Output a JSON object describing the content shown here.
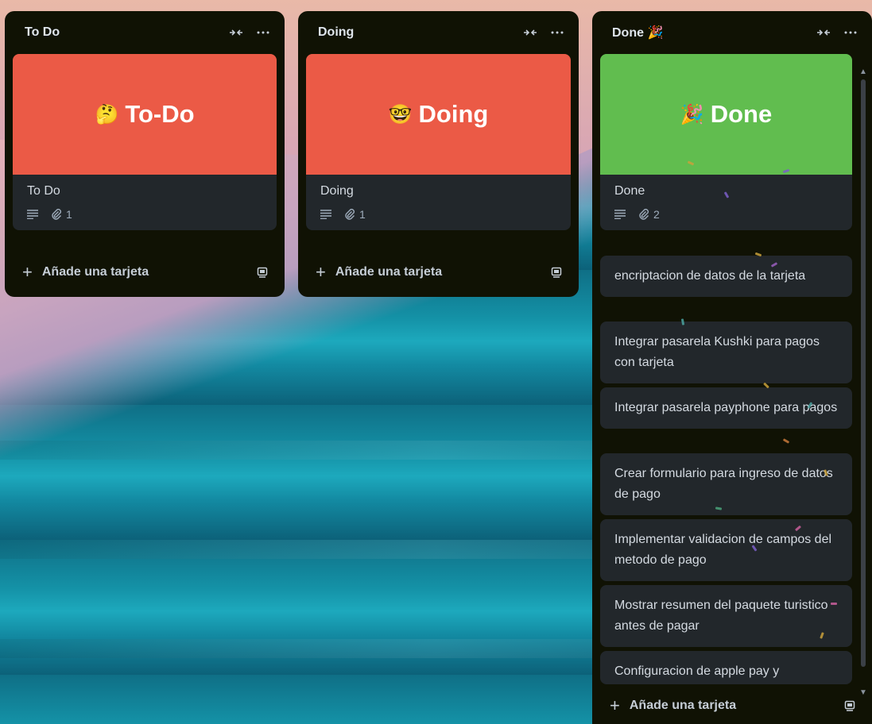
{
  "lists": [
    {
      "title": "To Do",
      "card": {
        "cover_emoji": "🤔",
        "cover_text": "To-Do",
        "cover_color": "#eb5a46",
        "title": "To Do",
        "attachments": "1"
      },
      "add_label": "Añade una tarjeta"
    },
    {
      "title": "Doing",
      "card": {
        "cover_emoji": "🤓",
        "cover_text": "Doing",
        "cover_color": "#eb5a46",
        "title": "Doing",
        "attachments": "1"
      },
      "add_label": "Añade una tarjeta"
    },
    {
      "title": "Done 🎉",
      "card": {
        "cover_emoji": "🎉",
        "cover_text": "Done",
        "cover_color": "#61bd4f",
        "title": "Done",
        "attachments": "2"
      },
      "add_label": "Añade una tarjeta",
      "cards": [
        "encriptacion de datos de la tarjeta",
        "Integrar pasarela Kushki para pagos con tarjeta",
        "Integrar pasarela payphone para pagos",
        "Crear formulario para ingreso de datos de pago",
        "Implementar validacion de campos del metodo de pago",
        "Mostrar resumen del paquete turistico antes de pagar",
        "Configuracion de apple pay y"
      ]
    }
  ],
  "icons": {
    "collapse": "collapse-icon",
    "more": "more-icon",
    "description": "description-icon",
    "attachment": "paperclip-icon",
    "add": "plus-icon",
    "template": "template-icon"
  },
  "colors": {
    "list_bg": "#101204",
    "card_bg": "#22272b",
    "cover_red": "#eb5a46",
    "cover_green": "#61bd4f"
  }
}
